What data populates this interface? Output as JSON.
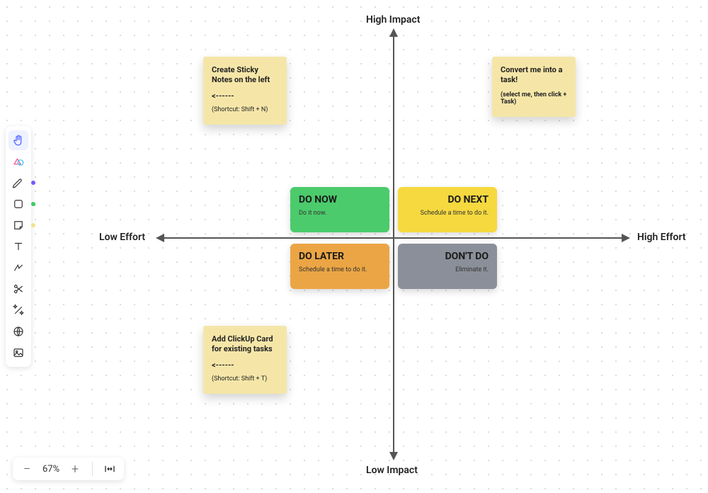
{
  "axes": {
    "top": "High Impact",
    "bottom": "Low Impact",
    "left": "Low Effort",
    "right": "High Effort"
  },
  "quadrants": {
    "do_now": {
      "title": "DO NOW",
      "sub": "Do it now.",
      "color": "#4BCB6C"
    },
    "do_next": {
      "title": "DO NEXT",
      "sub": "Schedule a time to do it.",
      "color": "#F5D93F"
    },
    "do_later": {
      "title": "DO LATER",
      "sub": "Schedule a time to do it.",
      "color": "#EBA544"
    },
    "dont_do": {
      "title": "DON'T DO",
      "sub": "Eliminate it.",
      "color": "#8B8F99"
    }
  },
  "stickies": {
    "create": {
      "title": "Create Sticky Notes on the left",
      "arrow": "<------",
      "shortcut": "(Shortcut: Shift + N)"
    },
    "convert": {
      "title": "Convert me into a task!",
      "sub": "(select me, then click + Task)"
    },
    "card": {
      "title": "Add ClickUp Card for existing tasks",
      "arrow": "<------",
      "shortcut": "(Shortcut: Shift + T)"
    }
  },
  "zoom": {
    "value": "67%"
  },
  "swatches": {
    "pen": "#6E5BFF",
    "shape": "#3BCB63",
    "sticky": "#F2E18C"
  }
}
